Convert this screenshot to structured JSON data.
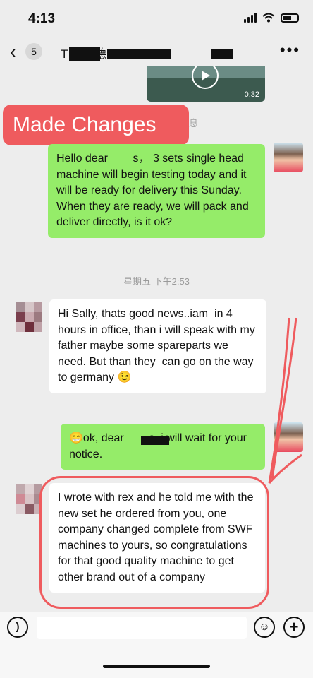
{
  "status_bar": {
    "time": "4:13"
  },
  "nav": {
    "unread_count": "5",
    "title": "T   ann 德"
  },
  "video": {
    "duration": "0:32"
  },
  "annotation": {
    "banner_text": "Made Changes",
    "system_note": "息"
  },
  "messages": [
    {
      "side": "self",
      "text": "Hello dear        s， 3 sets single head machine will begin testing today and it will be ready for delivery this Sunday.\nWhen they are ready, we will pack and deliver directly, is it ok?"
    },
    {
      "side": "other",
      "text": "Hi Sally, thats good news..iam  in 4 hours in office, than i will speak with my father maybe some spareparts we need. But than they  can go on the way to germany 😉"
    },
    {
      "side": "self",
      "text": "😁ok, dear        s, i will wait for your notice."
    },
    {
      "side": "other",
      "text": "I wrote with rex and he told me with the new set he ordered from you, one company changed complete from SWF machines to yours, so congratulations for that good quality machine to get other brand out of a company"
    }
  ],
  "timestamp": "星期五 下午2:53",
  "input": {
    "placeholder": ""
  },
  "icons": {
    "back": "chevron-left-icon",
    "more": "more-icon",
    "voice": "voice-icon",
    "emoji": "emoji-icon",
    "plus": "plus-icon"
  },
  "colors": {
    "self_bubble": "#95ec69",
    "annotation": "#ef5b5e",
    "background": "#ededed"
  }
}
